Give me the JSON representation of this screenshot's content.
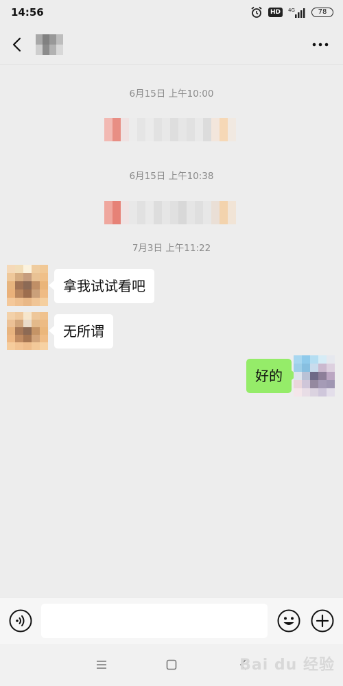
{
  "status_bar": {
    "time": "14:56",
    "hd_badge": "HD",
    "network": "4G",
    "battery": "78"
  },
  "header": {
    "back_icon": "chevron-left-icon",
    "more_icon": "more-dots-icon"
  },
  "messages": [
    {
      "type": "time",
      "text": "6月15日 上午10:00"
    },
    {
      "type": "time",
      "text": "6月15日 上午10:38"
    },
    {
      "type": "time",
      "text": "7月3日 上午11:22"
    },
    {
      "type": "incoming",
      "text": "拿我试试看吧"
    },
    {
      "type": "incoming",
      "text": "无所谓"
    },
    {
      "type": "outgoing",
      "text": "好的"
    }
  ],
  "input_bar": {
    "voice_icon": "voice-icon",
    "emoji_icon": "emoji-icon",
    "plus_icon": "plus-icon",
    "value": ""
  },
  "system_nav": {
    "menu_icon": "menu-icon",
    "home_icon": "home-square-icon",
    "back_icon": "back-arrow-icon"
  },
  "watermark": "Bai du 经验",
  "colors": {
    "background": "#ededed",
    "outgoing_bubble": "#95ec69",
    "incoming_bubble": "#ffffff",
    "timestamp_text": "#8a8a8a"
  }
}
